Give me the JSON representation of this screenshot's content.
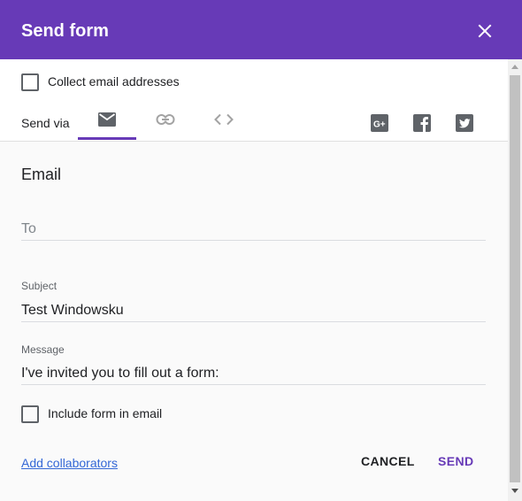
{
  "dialog": {
    "title": "Send form",
    "colors": {
      "header": "#673ab7",
      "accent": "#673ab7",
      "link": "#3367d6"
    }
  },
  "options": {
    "collect_email_label": "Collect email addresses",
    "collect_email_checked": false
  },
  "send_via": {
    "label": "Send via",
    "tabs": [
      {
        "name": "email",
        "icon": "email-icon",
        "active": true
      },
      {
        "name": "link",
        "icon": "link-icon",
        "active": false
      },
      {
        "name": "embed",
        "icon": "code-icon",
        "active": false
      }
    ],
    "social": [
      {
        "name": "google-plus",
        "icon": "google-plus-icon"
      },
      {
        "name": "facebook",
        "icon": "facebook-icon"
      },
      {
        "name": "twitter",
        "icon": "twitter-icon"
      }
    ]
  },
  "email": {
    "section_title": "Email",
    "to_placeholder": "To",
    "to_value": "",
    "subject_label": "Subject",
    "subject_value": "Test Windowsku",
    "message_label": "Message",
    "message_value": "I've invited you to fill out a form:",
    "include_form_label": "Include form in email",
    "include_form_checked": false
  },
  "footer": {
    "add_collaborators_label": "Add collaborators",
    "cancel_label": "CANCEL",
    "send_label": "SEND"
  }
}
